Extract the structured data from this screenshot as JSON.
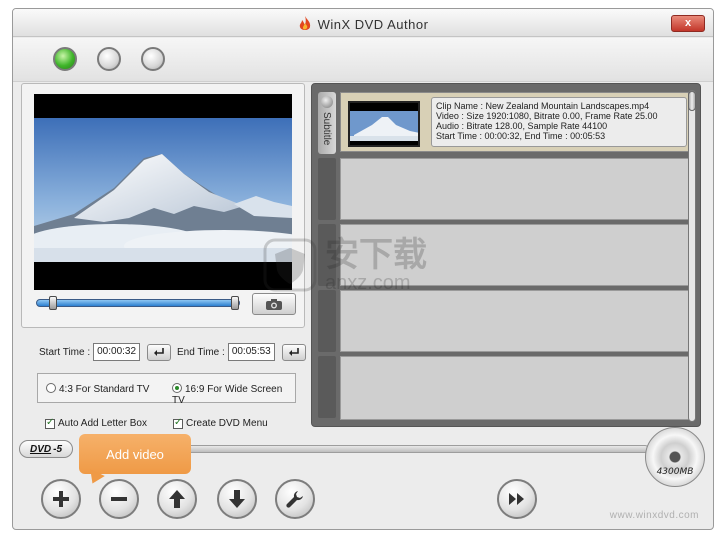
{
  "app": {
    "title": "WinX DVD Author",
    "close_label": "x",
    "brand_url": "www.winxdvd.com"
  },
  "steps": {
    "active_color": "#3fb52a",
    "inactive_color": "#d7d7d7"
  },
  "preview": {
    "seek_position": 0.0
  },
  "trim": {
    "start_label": "Start Time :",
    "start_value": "00:00:32",
    "end_label": "End Time :",
    "end_value": "00:05:53"
  },
  "aspect": {
    "option_43": "4:3 For Standard TV",
    "option_169": "16:9 For Wide Screen TV",
    "selected": "16:9"
  },
  "options": {
    "letterbox_label": "Auto Add Letter Box",
    "letterbox_checked": true,
    "menu_label": "Create DVD Menu",
    "menu_checked": true
  },
  "clips_panel": {
    "subtitle_tab": "Subtitle",
    "clips": [
      {
        "name_line": "Clip Name : New Zealand Mountain Landscapes.mp4",
        "video_line": "Video : Size 1920:1080, Bitrate 0.00, Frame Rate 25.00",
        "audio_line": "Audio : Bitrate 128.00, Sample Rate 44100",
        "time_line": "Start Time : 00:00:32, End Time : 00:05:53"
      }
    ]
  },
  "disc": {
    "type_label": "DVD",
    "type_suffix": "-5",
    "capacity_label": "4300MB",
    "used_fraction": 0.0
  },
  "tooltip": {
    "text": "Add video"
  },
  "watermark": {
    "text_cn": "安下载",
    "text_url": "anxz.com"
  },
  "icons": [
    "flame-icon",
    "camera-icon",
    "enter-icon",
    "plus-icon",
    "minus-icon",
    "arrow-up-icon",
    "arrow-down-icon",
    "wrench-icon",
    "next-icon",
    "disc-icon"
  ]
}
